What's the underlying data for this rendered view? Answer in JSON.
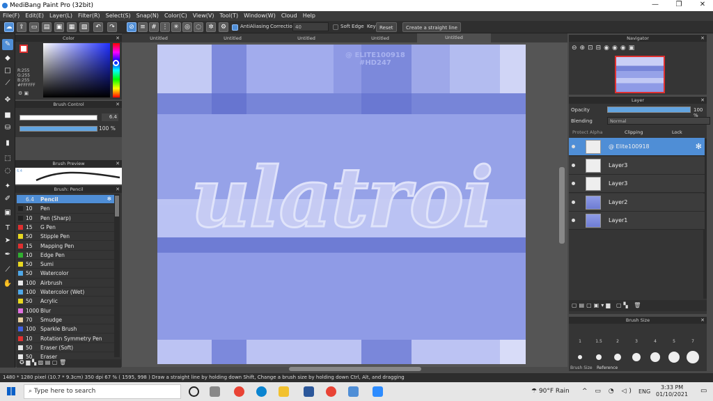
{
  "window": {
    "title": "MediBang Paint Pro (32bit)",
    "minimize": "—",
    "maximize": "❐",
    "close": "✕"
  },
  "menu": [
    "File(F)",
    "Edit(E)",
    "Layer(L)",
    "Filter(R)",
    "Select(S)",
    "Snap(N)",
    "Color(C)",
    "View(V)",
    "Tool(T)",
    "Window(W)",
    "Cloud",
    "Help"
  ],
  "toolbar": {
    "antialiasing": "AntiAliasing",
    "correction_label": "Correction",
    "correction_value": "40",
    "soft_edge": "Soft Edge",
    "key": "Key",
    "reset": "Reset",
    "straight_line": "Create a straight line"
  },
  "color_panel": {
    "title": "Color",
    "r": "R:255",
    "g": "G:255",
    "b": "B:255",
    "hex": "#FFFFFF"
  },
  "brush_control": {
    "title": "Brush Control",
    "size": "6.4",
    "opacity": "100 %"
  },
  "brush_preview": {
    "title": "Brush Preview",
    "size": "6.4"
  },
  "brush_list": {
    "title": "Brush: Pencil",
    "items": [
      {
        "size": "6.4",
        "name": "Pencil",
        "color": "#4f8ed6"
      },
      {
        "size": "10",
        "name": "Pen",
        "color": "#222222"
      },
      {
        "size": "10",
        "name": "Pen (Sharp)",
        "color": "#222222"
      },
      {
        "size": "15",
        "name": "G Pen",
        "color": "#e03030"
      },
      {
        "size": "50",
        "name": "Stipple Pen",
        "color": "#e8d820"
      },
      {
        "size": "15",
        "name": "Mapping Pen",
        "color": "#e03030"
      },
      {
        "size": "10",
        "name": "Edge Pen",
        "color": "#30b030"
      },
      {
        "size": "50",
        "name": "Sumi",
        "color": "#e8d820"
      },
      {
        "size": "50",
        "name": "Watercolor",
        "color": "#4fa8e8"
      },
      {
        "size": "100",
        "name": "Airbrush",
        "color": "#e8e8e8"
      },
      {
        "size": "100",
        "name": "Watercolor (Wet)",
        "color": "#4fa8e8"
      },
      {
        "size": "50",
        "name": "Acrylic",
        "color": "#e8d820"
      },
      {
        "size": "1000",
        "name": "Blur",
        "color": "#e070e0"
      },
      {
        "size": "70",
        "name": "Smudge",
        "color": "#e8d0a0"
      },
      {
        "size": "100",
        "name": "Sparkle Brush",
        "color": "#4060e0"
      },
      {
        "size": "10",
        "name": "Rotation Symmetry Pen",
        "color": "#e03030"
      },
      {
        "size": "50",
        "name": "Eraser (Soft)",
        "color": "#e8e8e8"
      },
      {
        "size": "50",
        "name": "Eraser",
        "color": "#e8e8e8"
      }
    ]
  },
  "tabs": [
    "Untitled",
    "Untitled",
    "Untitled",
    "Untitled",
    "Untitled"
  ],
  "canvas": {
    "watermark1": "@ ELITE100918",
    "watermark2": "#HD247",
    "lettering": "ulatroi"
  },
  "navigator": {
    "title": "Navigator"
  },
  "layer_panel": {
    "title": "Layer",
    "opacity_label": "Opacity",
    "opacity_value": "100 %",
    "blending_label": "Blending",
    "blending_value": "Normal",
    "protect_alpha": "Protect Alpha",
    "clipping": "Clipping",
    "lock": "Lock",
    "layers": [
      {
        "name": "@ Elite100918"
      },
      {
        "name": "Layer3"
      },
      {
        "name": "Layer3"
      },
      {
        "name": "Layer2"
      },
      {
        "name": "Layer1"
      }
    ]
  },
  "brush_size": {
    "title": "Brush Size",
    "tab1": "Brush Size",
    "tab2": "Reference",
    "sizes": [
      "1",
      "1.5",
      "2",
      "3",
      "4",
      "5",
      "7"
    ]
  },
  "status": {
    "text": "1480 * 1280 pixel   (10.7 * 9.3cm)   350 dpi   67 %   ( 1595, 998 )   Draw a straight line by holding down Shift, Change a brush size by holding down Ctrl, Alt, and dragging"
  },
  "taskbar": {
    "search": "Type here to search",
    "weather": "90°F  Rain",
    "lang": "ENG",
    "time": "3:33 PM",
    "date": "01/10/2021"
  }
}
